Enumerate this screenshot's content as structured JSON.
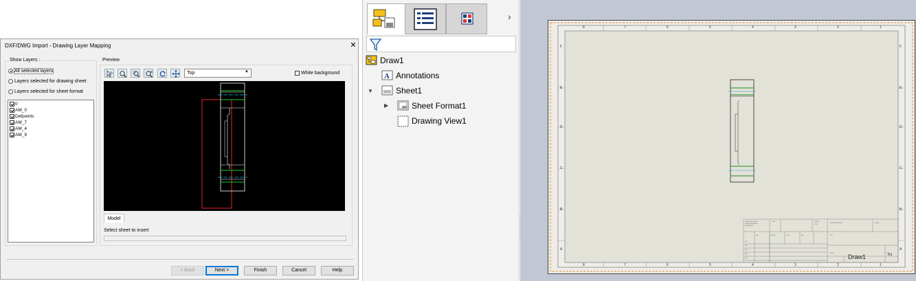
{
  "dialog": {
    "title": "DXF/DWG Import - Drawing Layer Mapping",
    "close": "✕",
    "show_layers": {
      "label": "Show Layers :",
      "options": [
        {
          "label": "All selected layers",
          "selected": true
        },
        {
          "label": "Layers selected for drawing sheet",
          "selected": false
        },
        {
          "label": "Layers selected for sheet format",
          "selected": false
        }
      ]
    },
    "layers": [
      {
        "name": "0",
        "checked": true
      },
      {
        "name": "AM_0",
        "checked": true
      },
      {
        "name": "Defpoints",
        "checked": true
      },
      {
        "name": "AM_7",
        "checked": true
      },
      {
        "name": "AM_4",
        "checked": true
      },
      {
        "name": "AM_9",
        "checked": true
      }
    ],
    "preview": {
      "label": "Preview",
      "toolbar_icons": [
        "select-icon",
        "zoom-fit-icon",
        "zoom-area-icon",
        "zoom-in-out-icon",
        "rotate-icon",
        "pan-icon"
      ],
      "view": "Top",
      "white_background": {
        "label": "White background",
        "checked": false
      },
      "tab": "Model",
      "select_sheet_label": "Select sheet to insert"
    },
    "buttons": {
      "back": "< Back",
      "next": "Next >",
      "finish": "Finish",
      "cancel": "Cancel",
      "help": "Help"
    }
  },
  "feature_manager": {
    "tabs": [
      "featuremanager-tree-icon",
      "propertymanager-icon",
      "configurationmanager-icon"
    ],
    "more": "›",
    "tree": [
      {
        "label": "Draw1",
        "icon": "drawing-icon"
      },
      {
        "label": "Annotations",
        "icon": "annotations-icon"
      },
      {
        "label": "Sheet1",
        "icon": "sheet-icon",
        "expanded": true
      },
      {
        "label": "Sheet Format1",
        "icon": "sheet-format-icon",
        "expanded": false
      },
      {
        "label": "Drawing View1",
        "icon": "drawing-view-icon"
      }
    ]
  },
  "sheet": {
    "zone_letters": [
      "F",
      "E",
      "D",
      "C",
      "B",
      "A"
    ],
    "zone_numbers": [
      "8",
      "7",
      "6",
      "5",
      "4",
      "3",
      "2",
      "1"
    ],
    "title_block_name": "Draw1",
    "sheet_size": "A3"
  },
  "colors": {
    "dialog_bg": "#f0f0f0",
    "preview_bg": "#000000",
    "sheet_bg": "#eeede9",
    "canvas_bg": "#c1c7d3",
    "accent": "#0078d7"
  }
}
